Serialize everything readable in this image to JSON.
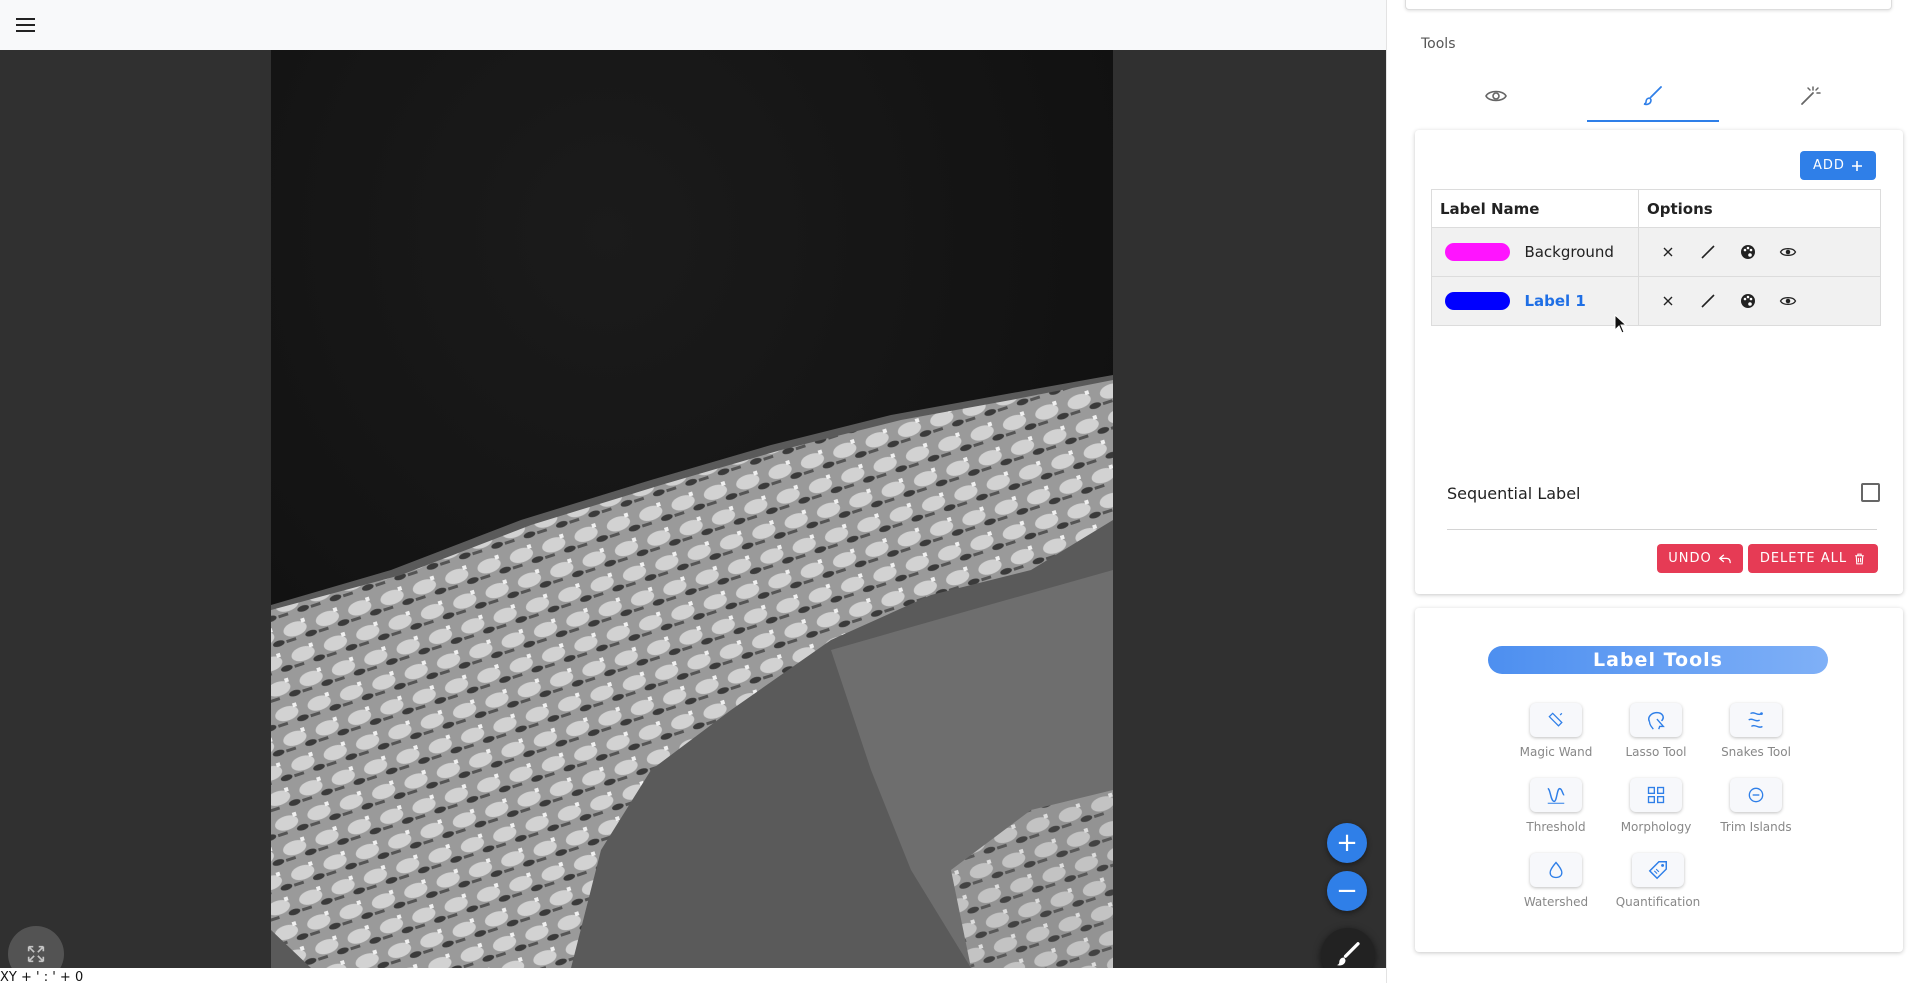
{
  "header": {
    "menu_icon": "hamburger-menu-icon"
  },
  "viewer": {
    "coords": "XY + ' : ' + 0",
    "zoom_in_label": "+",
    "zoom_out_label": "−",
    "expand_icon": "expand-arrows-icon",
    "paint_icon": "paintbrush-icon"
  },
  "tools_panel": {
    "title": "Tools",
    "tabs": [
      {
        "icon": "eye-icon",
        "active": false
      },
      {
        "icon": "paintbrush-icon",
        "active": true
      },
      {
        "icon": "magic-wand-icon",
        "active": false
      }
    ],
    "add_label": "ADD",
    "table": {
      "headers": [
        "Label Name",
        "Options"
      ],
      "rows": [
        {
          "name": "Background",
          "color": "#ff14ff",
          "active": false
        },
        {
          "name": "Label 1",
          "color": "#0000ff",
          "active": true
        }
      ]
    },
    "sequential_label": "Sequential Label",
    "sequential_checked": false,
    "undo_label": "UNDO",
    "delete_all_label": "DELETE ALL"
  },
  "label_tools": {
    "title": "Label Tools",
    "tools": [
      {
        "name": "Magic Wand",
        "icon": "magic-wand-icon"
      },
      {
        "name": "Lasso Tool",
        "icon": "lasso-icon"
      },
      {
        "name": "Snakes Tool",
        "icon": "snakes-icon"
      },
      {
        "name": "Threshold",
        "icon": "threshold-icon"
      },
      {
        "name": "Morphology",
        "icon": "grid-icon"
      },
      {
        "name": "Trim Islands",
        "icon": "minus-circle-icon"
      },
      {
        "name": "Watershed",
        "icon": "water-drop-icon"
      },
      {
        "name": "Quantification",
        "icon": "tag-icon"
      }
    ]
  },
  "colors": {
    "accent": "#2f7fe8",
    "danger": "#e63b55",
    "viewer_bg": "#303030"
  }
}
